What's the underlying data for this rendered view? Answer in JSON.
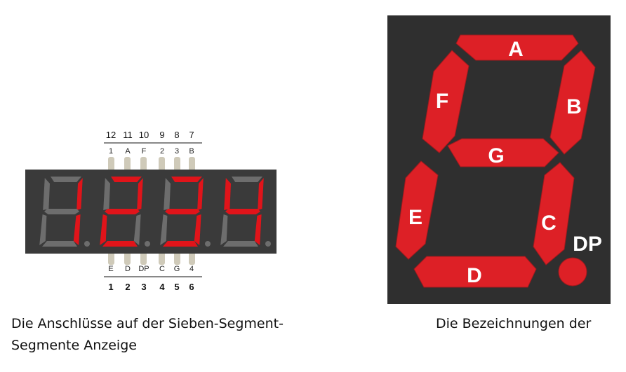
{
  "left_figure": {
    "pins_top_numbers": [
      "12",
      "11",
      "10",
      "9",
      "8",
      "7"
    ],
    "pins_top_labels": [
      "1",
      "A",
      "F",
      "2",
      "3",
      "B"
    ],
    "pins_bottom_labels": [
      "E",
      "D",
      "DP",
      "C",
      "G",
      "4"
    ],
    "pins_bottom_numbers": [
      "1",
      "2",
      "3",
      "4",
      "5",
      "6"
    ],
    "display_digits": [
      "1",
      "2",
      "3",
      "4"
    ],
    "colors": {
      "body": "#3a3a3a",
      "segment_on": "#e0141a",
      "segment_off": "#6d6d6d",
      "pin": "#c8c4b8"
    }
  },
  "right_figure": {
    "segment_labels": {
      "a": "A",
      "b": "B",
      "c": "C",
      "d": "D",
      "e": "E",
      "f": "F",
      "g": "G",
      "dp": "DP"
    },
    "colors": {
      "background": "#2f2f2f",
      "segment": "#dd2026",
      "label": "#ffffff"
    }
  },
  "captions": {
    "left_line1": "Die Anschlüsse auf der Sieben-Segment-",
    "left_line2": "Segmente Anzeige",
    "right": "Die Bezeichnungen der"
  }
}
